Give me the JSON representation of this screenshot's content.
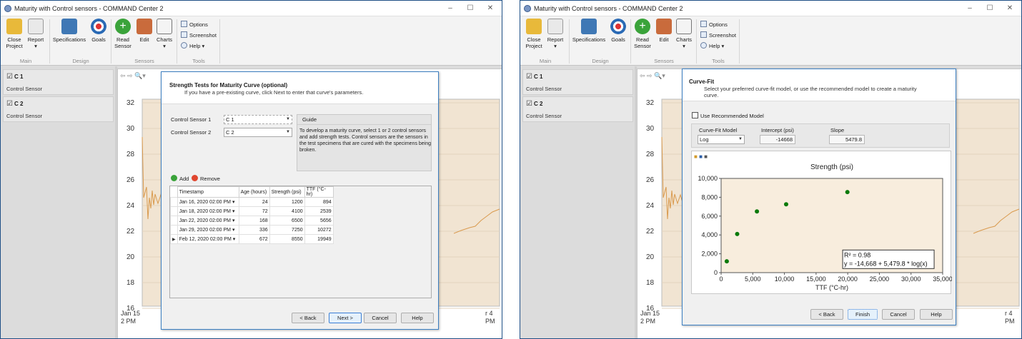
{
  "window": {
    "title": "Maturity with Control sensors - COMMAND Center 2",
    "minimize": "–",
    "maximize": "☐",
    "close": "✕"
  },
  "ribbon": {
    "close_project": "Close\nProject",
    "report": "Report",
    "specifications": "Specifications",
    "goals": "Goals",
    "read_sensor": "Read\nSensor",
    "edit": "Edit",
    "charts": "Charts",
    "options": "Options",
    "screenshot": "Screenshot",
    "help": "Help",
    "groups": {
      "main": "Main",
      "design": "Design",
      "sensors": "Sensors",
      "tools": "Tools"
    }
  },
  "sensors": [
    {
      "name": "C 1",
      "type": "Control Sensor"
    },
    {
      "name": "C 2",
      "type": "Control Sensor"
    }
  ],
  "background_chart": {
    "y_ticks": [
      "32",
      "30",
      "28",
      "26",
      "24",
      "22",
      "20",
      "18",
      "16"
    ],
    "x_start_line1": "Jan 15",
    "x_start_line2": "2 PM",
    "x_end_line1": "r 4",
    "x_end_line2": "PM",
    "legend": [
      "C 1",
      "C 2"
    ],
    "colors": {
      "c1": "#4a7cc7",
      "c2": "#d99a4e"
    }
  },
  "dialog1": {
    "title": "Strength Tests for Maturity Curve (optional)",
    "subtitle": "If you have a pre-existing curve, click Next to enter that curve's parameters.",
    "control_sensor_1_label": "Control Sensor 1",
    "control_sensor_1_value": "C 1",
    "control_sensor_2_label": "Control Sensor 2",
    "control_sensor_2_value": "C 2",
    "guide_title": "Guide",
    "guide_text": "To develop a maturity curve, select 1 or 2 control sensors and add strength tests. Control sensors are the sensors in the test specimens that are cured with the specimens being broken.",
    "add": "Add",
    "remove": "Remove",
    "columns": [
      "Timestamp",
      "Age (hours)",
      "Strength (psi)",
      "TTF (°C-hr)"
    ],
    "rows": [
      {
        "timestamp": "Jan 16, 2020 02:00 PM",
        "age": "24",
        "strength": "1200",
        "ttf": "894"
      },
      {
        "timestamp": "Jan 18, 2020 02:00 PM",
        "age": "72",
        "strength": "4100",
        "ttf": "2539"
      },
      {
        "timestamp": "Jan 22, 2020 02:00 PM",
        "age": "168",
        "strength": "6500",
        "ttf": "5656"
      },
      {
        "timestamp": "Jan 29, 2020 02:00 PM",
        "age": "336",
        "strength": "7250",
        "ttf": "10272"
      },
      {
        "timestamp": "Feb 12, 2020 02:00 PM",
        "age": "672",
        "strength": "8550",
        "ttf": "19949"
      }
    ],
    "back": "< Back",
    "next": "Next >",
    "cancel": "Cancel",
    "help": "Help"
  },
  "dialog2": {
    "title": "Curve-Fit",
    "subtitle": "Select your preferred curve-fit model, or use the recommended model to create a maturity curve.",
    "use_recommended": "Use Recommended Model",
    "model_label": "Curve-Fit Model",
    "model_value": "Log",
    "intercept_label": "Intercept (psi)",
    "intercept_value": "-14668",
    "slope_label": "Slope",
    "slope_value": "5479.8",
    "back": "< Back",
    "finish": "Finish",
    "cancel": "Cancel",
    "help": "Help"
  },
  "chart_data": {
    "type": "scatter",
    "title": "Strength (psi)",
    "xlabel": "TTF (°C-hr)",
    "ylabel": "",
    "xlim": [
      0,
      35000
    ],
    "ylim": [
      0,
      10000
    ],
    "x_ticks": [
      "0",
      "5,000",
      "10,000",
      "15,000",
      "20,000",
      "25,000",
      "30,000",
      "35,000"
    ],
    "y_ticks": [
      "0",
      "2,000",
      "4,000",
      "6,000",
      "8,000",
      "10,000"
    ],
    "points": {
      "x": [
        894,
        2539,
        5656,
        10272,
        19949
      ],
      "y": [
        1200,
        4100,
        6500,
        7250,
        8550
      ]
    },
    "fit": {
      "model": "log",
      "intercept": -14668,
      "slope": 5479.8,
      "x_range": [
        700,
        30000
      ]
    },
    "annotation_r2": "R² = 0.98",
    "annotation_eq": "y = -14,668 + 5,479.8 * log(x)",
    "colors": {
      "points": "#0a7a0a",
      "curve": "#c98a10",
      "plot_bg": "#f8eddd"
    }
  }
}
